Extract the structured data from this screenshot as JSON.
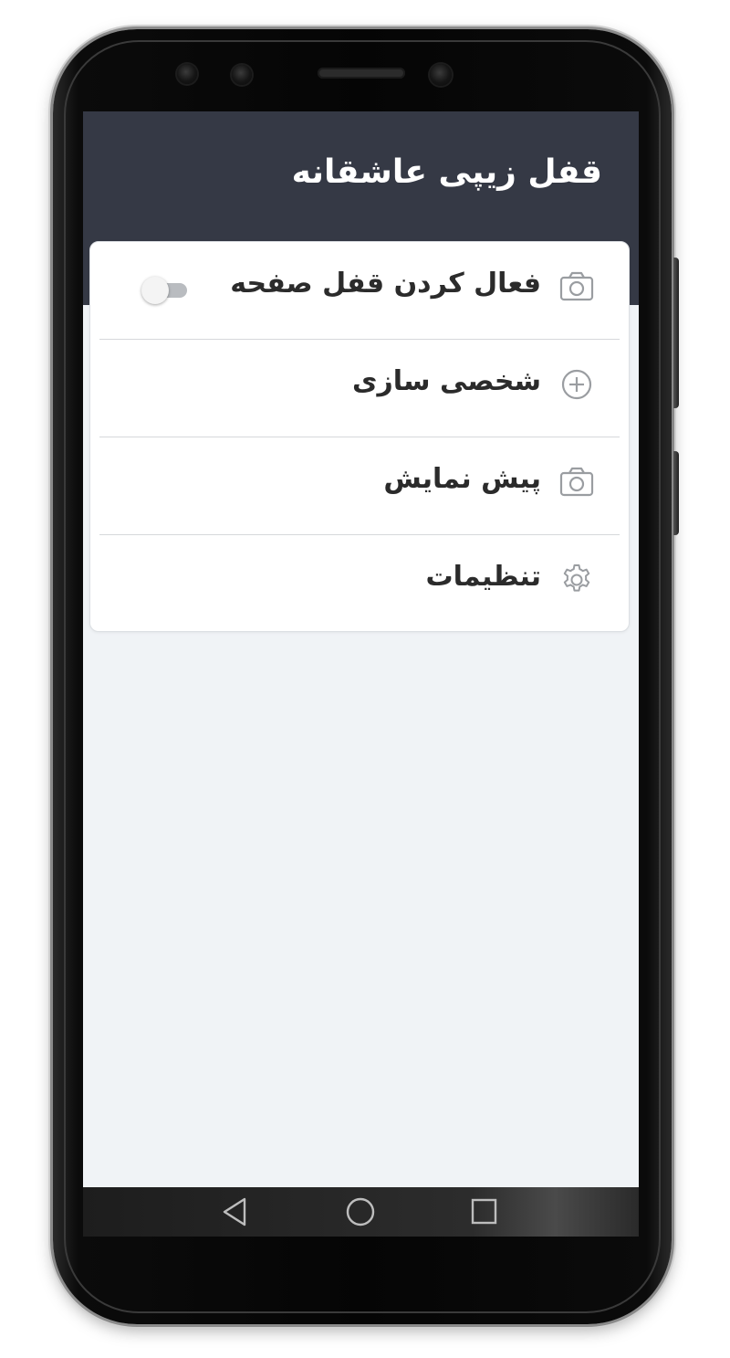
{
  "app": {
    "title": "قفل زیپی عاشقانه"
  },
  "menu": {
    "items": [
      {
        "label": "فعال کردن قفل صفحه",
        "icon": "camera-icon",
        "has_toggle": true,
        "toggle_on": false
      },
      {
        "label": "شخصی سازی",
        "icon": "plus-circle-icon",
        "has_toggle": false
      },
      {
        "label": "پیش نمایش",
        "icon": "camera-icon",
        "has_toggle": false
      },
      {
        "label": "تنظیمات",
        "icon": "gear-icon",
        "has_toggle": false
      }
    ]
  },
  "navigation": {
    "buttons": [
      {
        "name": "back",
        "icon": "triangle-back-icon"
      },
      {
        "name": "home",
        "icon": "circle-home-icon"
      },
      {
        "name": "recents",
        "icon": "square-recents-icon"
      }
    ]
  },
  "colors": {
    "header_bg": "#353945",
    "screen_bg": "#f0f3f6",
    "card_bg": "#ffffff",
    "text": "#2b2b2b",
    "icon": "#9a9da1"
  }
}
